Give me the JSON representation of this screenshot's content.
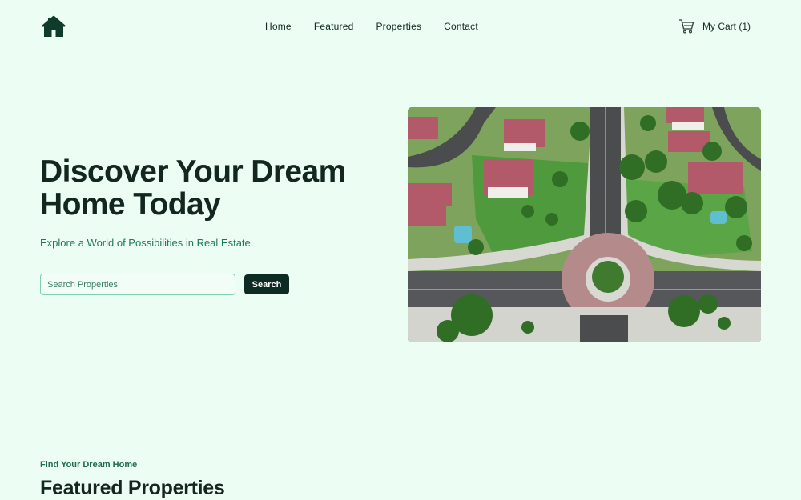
{
  "nav": {
    "logo_icon": "house-icon",
    "items": [
      {
        "label": "Home"
      },
      {
        "label": "Featured"
      },
      {
        "label": "Properties"
      },
      {
        "label": "Contact"
      }
    ],
    "cart": {
      "icon": "cart-icon",
      "label": "My Cart (1)"
    }
  },
  "hero": {
    "title": "Discover Your Dream Home Today",
    "subtitle": "Explore a World of Possibilities in Real Estate.",
    "search": {
      "placeholder": "Search Properties",
      "button_label": "Search"
    },
    "image_icon": "aerial-neighborhood-photo"
  },
  "featured": {
    "eyebrow": "Find Your Dream Home",
    "title": "Featured Properties"
  },
  "colors": {
    "background": "#ecfdf3",
    "primary_dark": "#0d2b22",
    "accent_green": "#1f7a5b",
    "input_border": "#7fd0ad"
  }
}
